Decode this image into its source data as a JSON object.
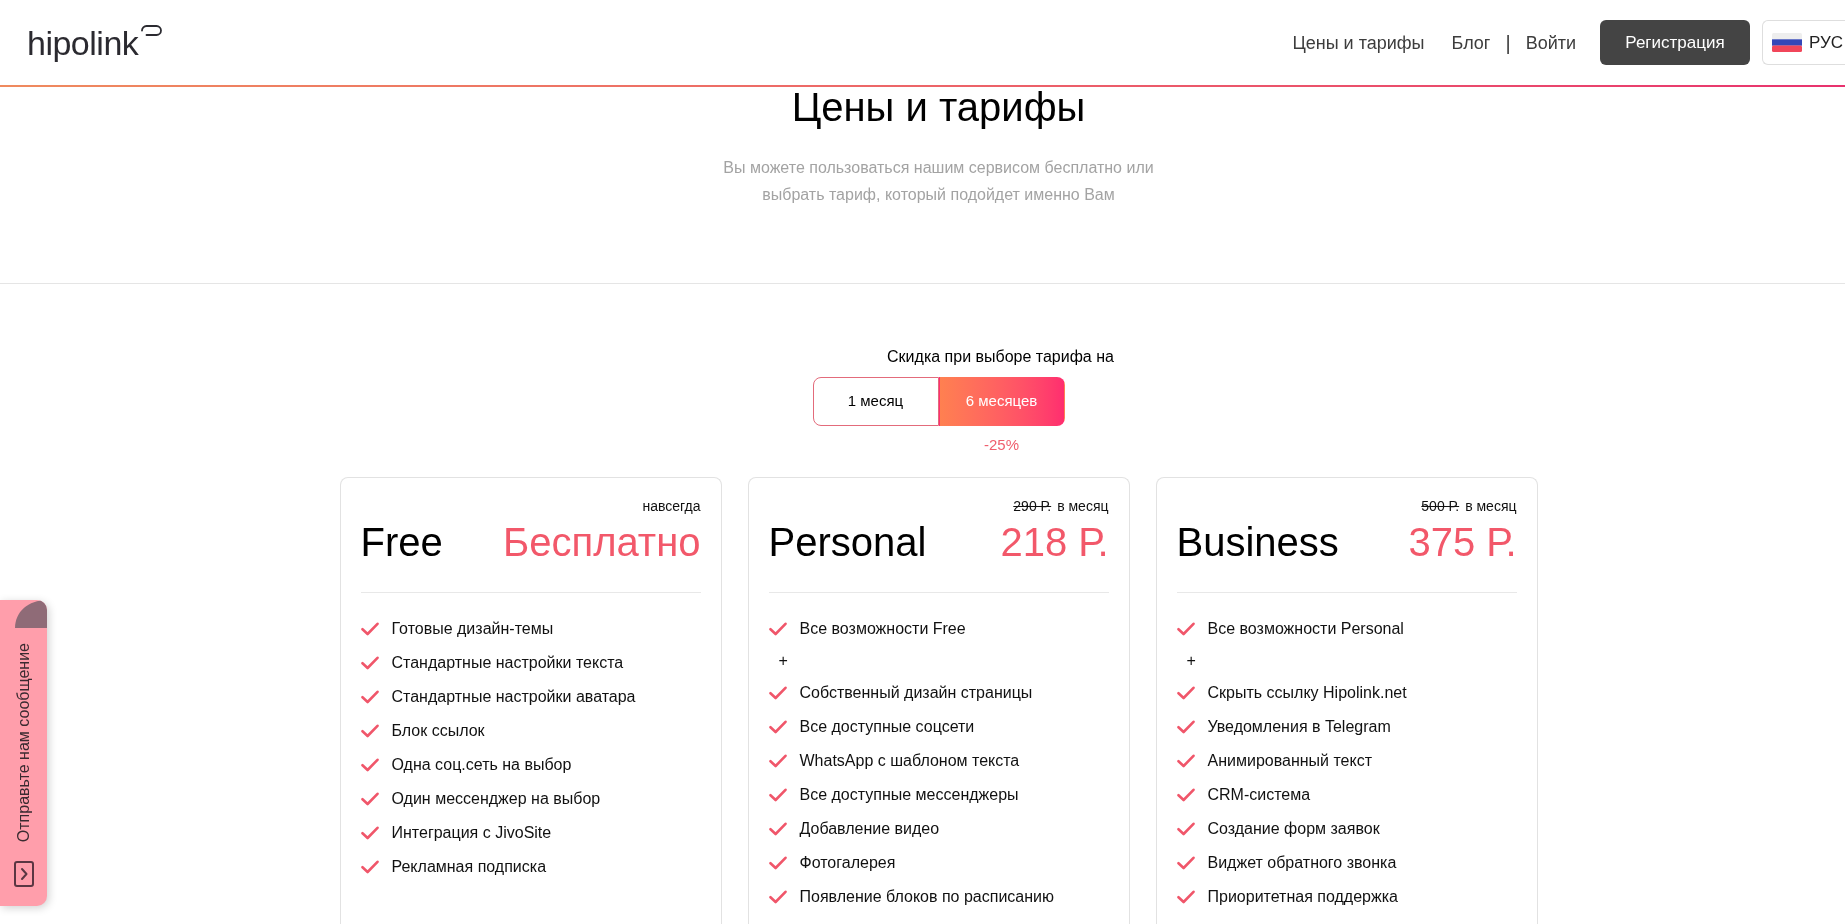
{
  "header": {
    "logo": "hipolink",
    "nav_links": [
      "Цены и тарифы",
      "Блог"
    ],
    "separator": "|",
    "login": "Войти",
    "register_button": "Регистрация",
    "language": "РУС"
  },
  "hero": {
    "title": "Цены и тарифы",
    "subtitle": "Вы можете пользоваться нашим сервисом бесплатно или выбрать тариф, который подойдет именно Вам"
  },
  "billing": {
    "label": "Скидка при выборе тарифа на",
    "options": [
      {
        "label": "1 месяц",
        "selected": false
      },
      {
        "label": "6 месяцев",
        "selected": true,
        "discount": "-25%"
      }
    ]
  },
  "plans": [
    {
      "name": "Free",
      "period": "навсегда",
      "price": "Бесплатно",
      "features": [
        {
          "kind": "check",
          "text": "Готовые дизайн-темы"
        },
        {
          "kind": "check",
          "text": "Стандартные настройки текста"
        },
        {
          "kind": "check",
          "text": "Стандартные настройки аватара"
        },
        {
          "kind": "check",
          "text": "Блок ссылок"
        },
        {
          "kind": "check",
          "text": "Одна соц.сеть на выбор"
        },
        {
          "kind": "check",
          "text": "Один мессенджер на выбор"
        },
        {
          "kind": "check",
          "text": "Интеграция с JivoSite"
        },
        {
          "kind": "check",
          "text": "Рекламная подписка"
        }
      ]
    },
    {
      "name": "Personal",
      "old_price": "290 Р.",
      "period": "в месяц",
      "price": "218 Р.",
      "features": [
        {
          "kind": "check",
          "text": "Все возможности Free"
        },
        {
          "kind": "plus",
          "text": "+"
        },
        {
          "kind": "check",
          "text": "Собственный дизайн страницы"
        },
        {
          "kind": "check",
          "text": "Все доступные соцсети"
        },
        {
          "kind": "check",
          "text": "WhatsApp с шаблоном текста"
        },
        {
          "kind": "check",
          "text": "Все доступные мессенджеры"
        },
        {
          "kind": "check",
          "text": "Добавление видео"
        },
        {
          "kind": "check",
          "text": "Фотогалерея"
        },
        {
          "kind": "check",
          "text": "Появление блоков по расписанию"
        }
      ]
    },
    {
      "name": "Business",
      "old_price": "500 Р.",
      "period": "в месяц",
      "price": "375 Р.",
      "features": [
        {
          "kind": "check",
          "text": "Все возможности Personal"
        },
        {
          "kind": "plus",
          "text": "+"
        },
        {
          "kind": "check",
          "text": "Скрыть ссылку Hipolink.net"
        },
        {
          "kind": "check",
          "text": "Уведомления в Telegram"
        },
        {
          "kind": "check",
          "text": "Анимированный текст"
        },
        {
          "kind": "check",
          "text": "CRM-система"
        },
        {
          "kind": "check",
          "text": "Создание форм заявок"
        },
        {
          "kind": "check",
          "text": "Виджет обратного звонка"
        },
        {
          "kind": "check",
          "text": "Приоритетная поддержка"
        }
      ]
    }
  ],
  "feedback_tab": {
    "label": "Отправьте нам сообщение"
  }
}
